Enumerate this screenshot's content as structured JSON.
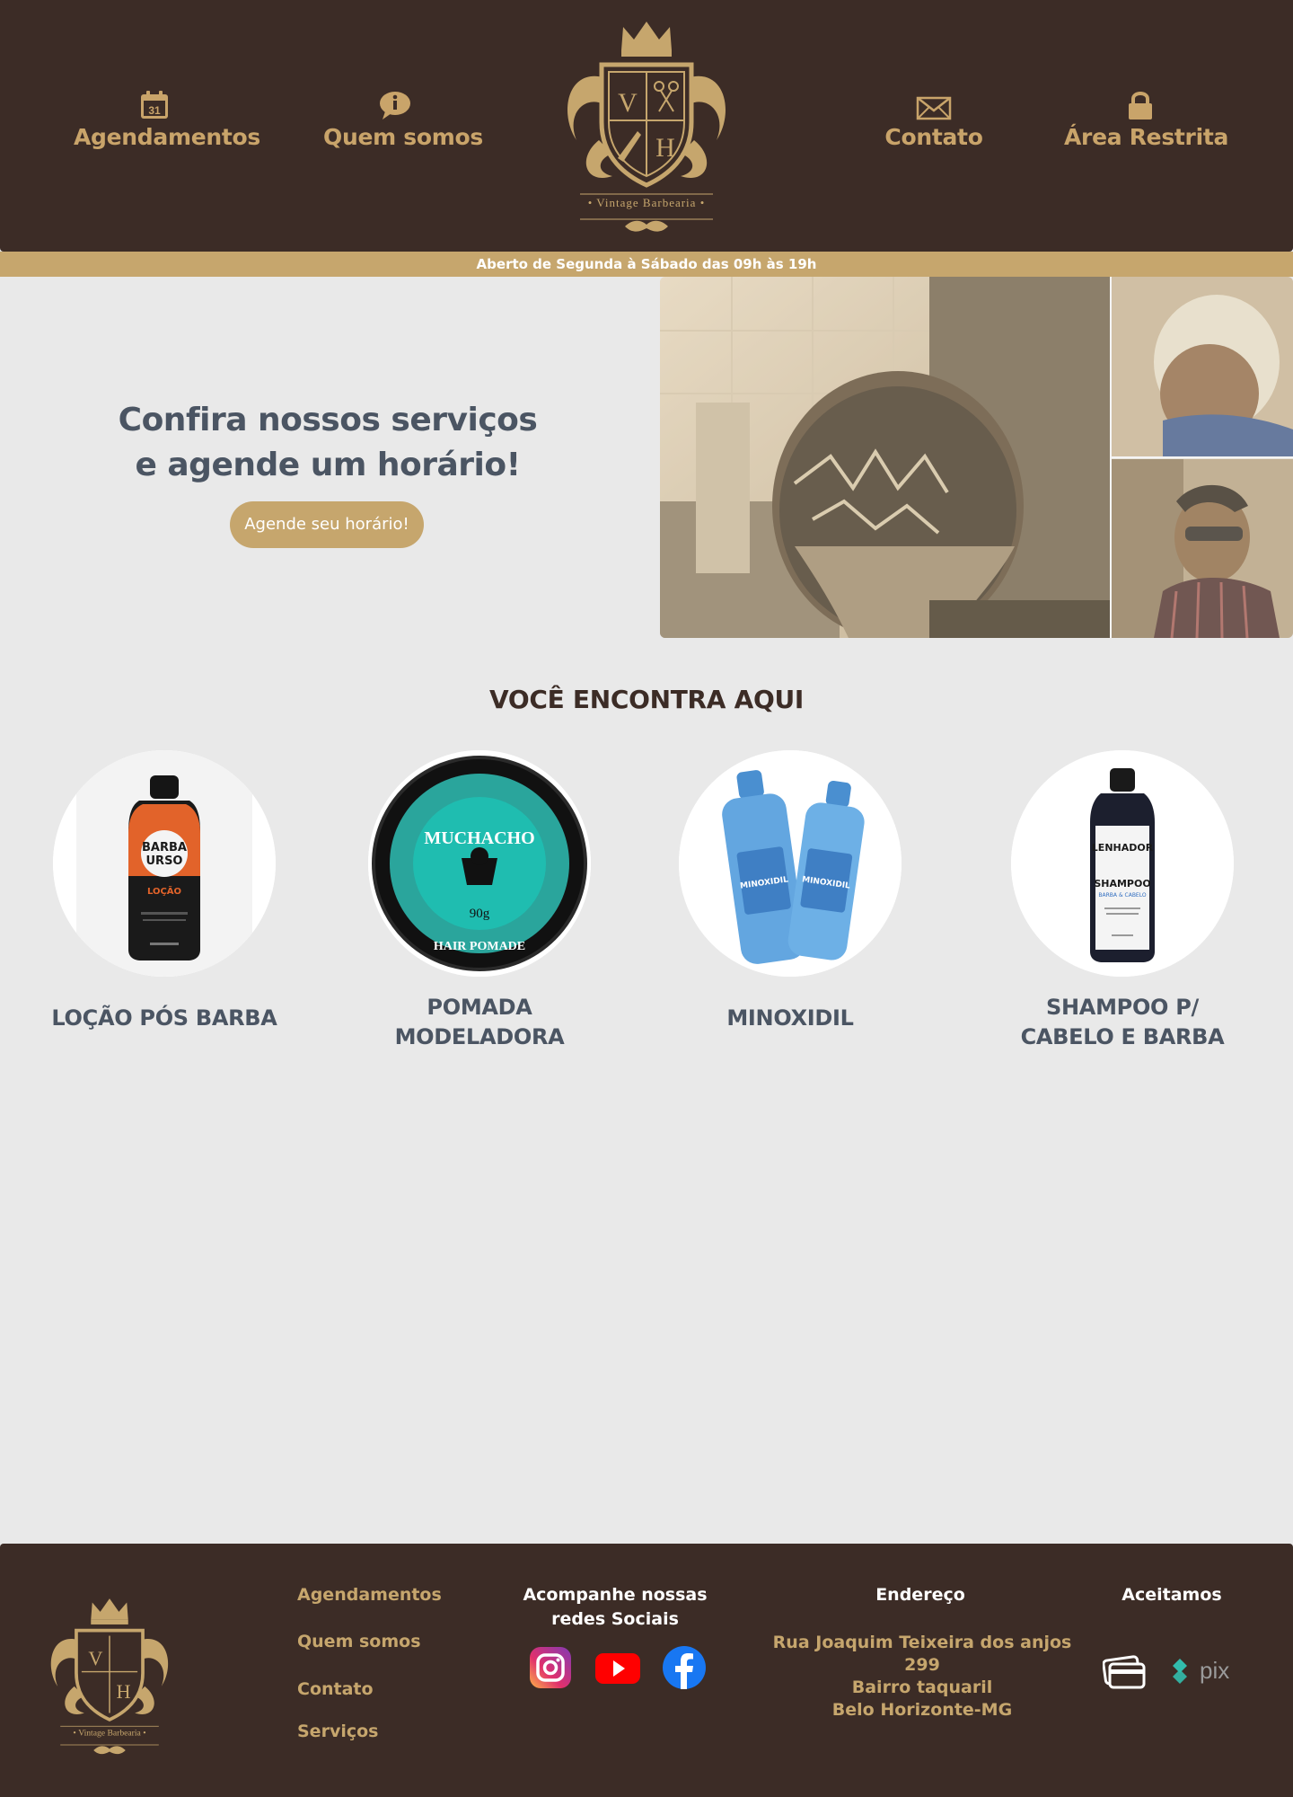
{
  "header": {
    "nav_left": [
      {
        "label": "Agendamentos",
        "icon": "calendar-icon",
        "icon_text": "31"
      },
      {
        "label": "Quem somos",
        "icon": "chat-info-icon"
      }
    ],
    "nav_right": [
      {
        "label": "Contato",
        "icon": "envelope-icon"
      },
      {
        "label": "Área Restrita",
        "icon": "lock-icon"
      }
    ],
    "logo": {
      "monogram_left": "V",
      "monogram_right": "H",
      "brand": "Vintage Barbearia"
    }
  },
  "hours": "Aberto de Segunda à Sábado das 09h às 19h",
  "hero": {
    "title_line1": "Confira nossos serviços",
    "title_line2": "e agende um horário!",
    "button": "Agende seu horário!"
  },
  "products_section": {
    "title": "VOCÊ ENCONTRA AQUI",
    "items": [
      {
        "name_line1": "LOÇÃO PÓS BARBA",
        "name_line2": "",
        "label_top": "BARBA",
        "label_mid": "URSO",
        "label_sub": "LOÇÃO"
      },
      {
        "name_line1": "POMADA",
        "name_line2": "MODELADORA",
        "label_top": "MUCHACHO",
        "label_mid": "90g",
        "label_sub": "HAIR POMADE"
      },
      {
        "name_line1": "MINOXIDIL",
        "name_line2": "",
        "label_top": "MINOXIDIL"
      },
      {
        "name_line1": "SHAMPOO P/",
        "name_line2": "CABELO E BARBA",
        "label_top": "LENHADOR",
        "label_mid": "SHAMPOO",
        "label_sub": "BARBA & CABELO"
      }
    ]
  },
  "footer": {
    "links": [
      "Agendamentos",
      "Quem somos",
      "Contato",
      "Serviços"
    ],
    "social_title_line1": "Acompanhe nossas",
    "social_title_line2": "redes Sociais",
    "social": [
      "instagram-icon",
      "youtube-icon",
      "facebook-icon"
    ],
    "address_title": "Endereço",
    "address": [
      "Rua Joaquim Teixeira dos anjos 299",
      "Bairro taquaril",
      "Belo Horizonte-MG"
    ],
    "payment_title": "Aceitamos",
    "payment": [
      "card-icon",
      "pix"
    ]
  },
  "colors": {
    "brown": "#3c2c26",
    "gold": "#c6a66d",
    "text_gray": "#4b5563",
    "background": "#e9e9e9"
  }
}
